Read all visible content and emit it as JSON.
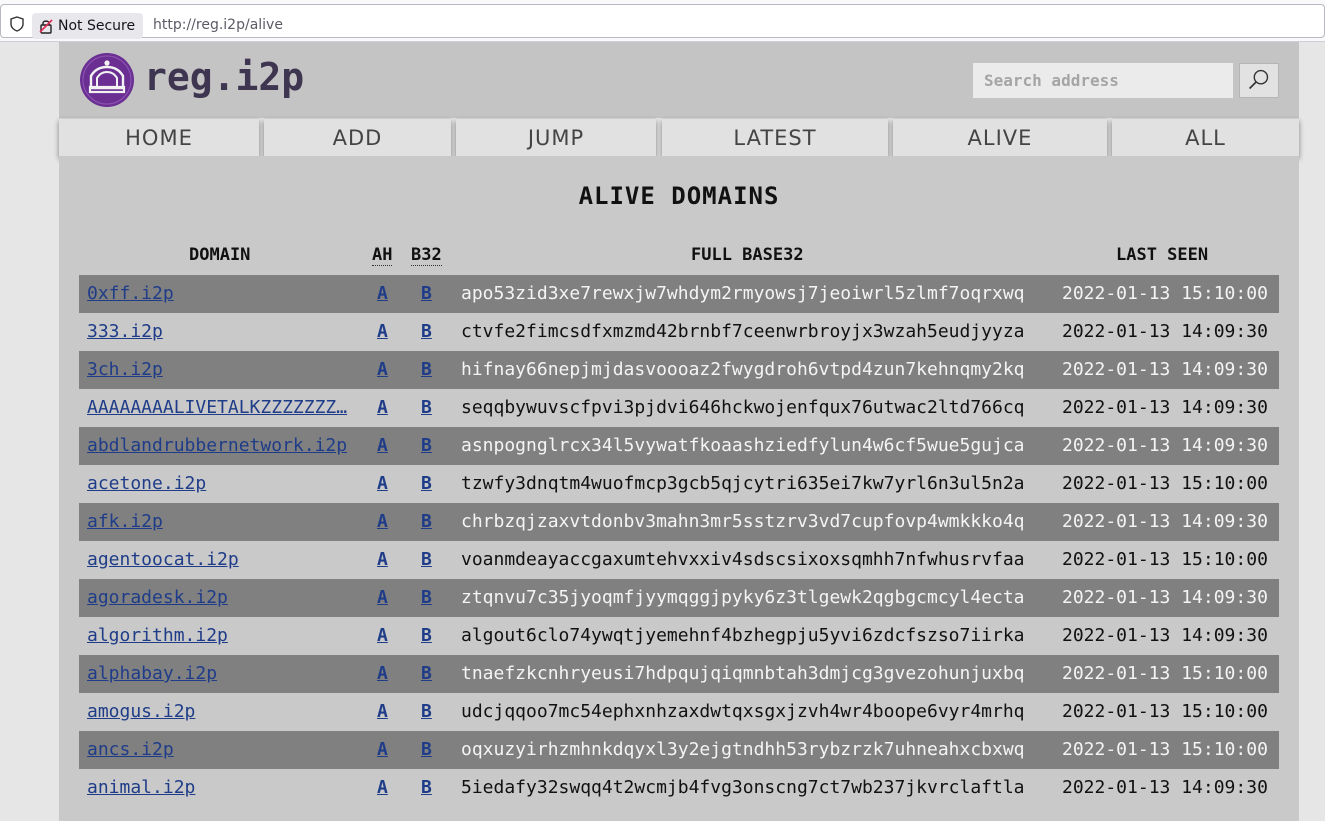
{
  "browser": {
    "security_label": "Not Secure",
    "url": "http://reg.i2p/alive"
  },
  "site": {
    "title": "reg.i2p",
    "search_placeholder": "Search address"
  },
  "nav": [
    "HOME",
    "ADD",
    "JUMP",
    "LATEST",
    "ALIVE",
    "ALL"
  ],
  "heading": "ALIVE DOMAINS",
  "columns": {
    "domain": "DOMAIN",
    "ah": "AH",
    "b32": "B32",
    "full_base32": "FULL BASE32",
    "last_seen": "LAST SEEN"
  },
  "rows": [
    {
      "domain": "0xff.i2p",
      "a": "A",
      "b": "B",
      "base32": "apo53zid3xe7rewxjw7whdym2rmyowsj7jeoiwrl5zlmf7oqrxwq",
      "last_seen": "2022-01-13 15:10:00"
    },
    {
      "domain": "333.i2p",
      "a": "A",
      "b": "B",
      "base32": "ctvfe2fimcsdfxmzmd42brnbf7ceenwrbroyjx3wzah5eudjyyza",
      "last_seen": "2022-01-13 14:09:30"
    },
    {
      "domain": "3ch.i2p",
      "a": "A",
      "b": "B",
      "base32": "hifnay66nepjmjdasvoooaz2fwygdroh6vtpd4zun7kehnqmy2kq",
      "last_seen": "2022-01-13 14:09:30"
    },
    {
      "domain": "AAAAAAAALIVETALKZZZZZZZ…",
      "a": "A",
      "b": "B",
      "base32": "seqqbywuvscfpvi3pjdvi646hckwojenfqux76utwac2ltd766cq",
      "last_seen": "2022-01-13 14:09:30"
    },
    {
      "domain": "abdlandrubbernetwork.i2p",
      "a": "A",
      "b": "B",
      "base32": "asnpognglrcx34l5vywatfkoaashziedfylun4w6cf5wue5gujca",
      "last_seen": "2022-01-13 14:09:30"
    },
    {
      "domain": "acetone.i2p",
      "a": "A",
      "b": "B",
      "base32": "tzwfy3dnqtm4wuofmcp3gcb5qjcytri635ei7kw7yrl6n3ul5n2a",
      "last_seen": "2022-01-13 15:10:00"
    },
    {
      "domain": "afk.i2p",
      "a": "A",
      "b": "B",
      "base32": "chrbzqjzaxvtdonbv3mahn3mr5sstzrv3vd7cupfovp4wmkkko4q",
      "last_seen": "2022-01-13 14:09:30"
    },
    {
      "domain": "agentoocat.i2p",
      "a": "A",
      "b": "B",
      "base32": "voanmdeayaccgaxumtehvxxiv4sdscsixoxsqmhh7nfwhusrvfaa",
      "last_seen": "2022-01-13 15:10:00"
    },
    {
      "domain": "agoradesk.i2p",
      "a": "A",
      "b": "B",
      "base32": "ztqnvu7c35jyoqmfjyymqggjpyky6z3tlgewk2qgbgcmcyl4ecta",
      "last_seen": "2022-01-13 14:09:30"
    },
    {
      "domain": "algorithm.i2p",
      "a": "A",
      "b": "B",
      "base32": "algout6clo74ywqtjyemehnf4bzhegpju5yvi6zdcfszso7iirka",
      "last_seen": "2022-01-13 14:09:30"
    },
    {
      "domain": "alphabay.i2p",
      "a": "A",
      "b": "B",
      "base32": "tnaefzkcnhryeusi7hdpqujqiqmnbtah3dmjcg3gvezohunjuxbq",
      "last_seen": "2022-01-13 15:10:00"
    },
    {
      "domain": "amogus.i2p",
      "a": "A",
      "b": "B",
      "base32": "udcjqqoo7mc54ephxnhzaxdwtqxsgxjzvh4wr4boope6vyr4mrhq",
      "last_seen": "2022-01-13 15:10:00"
    },
    {
      "domain": "ancs.i2p",
      "a": "A",
      "b": "B",
      "base32": "oqxuzyirhzmhnkdqyxl3y2ejgtndhh53rybzrzk7uhneahxcbxwq",
      "last_seen": "2022-01-13 15:10:00"
    },
    {
      "domain": "animal.i2p",
      "a": "A",
      "b": "B",
      "base32": "5iedafy32swqq4t2wcmjb4fvg3onscng7ct7wb237jkvrclaftla",
      "last_seen": "2022-01-13 14:09:30"
    }
  ]
}
